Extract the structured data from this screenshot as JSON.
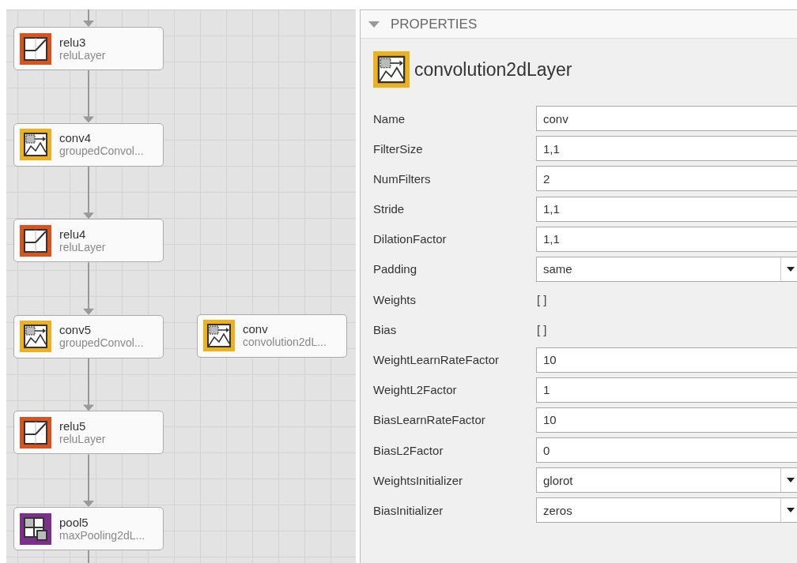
{
  "canvas": {
    "chain": [
      {
        "name": "relu3",
        "type": "reluLayer",
        "kind": "relu"
      },
      {
        "name": "conv4",
        "type": "groupedConvol...",
        "kind": "conv"
      },
      {
        "name": "relu4",
        "type": "reluLayer",
        "kind": "relu"
      },
      {
        "name": "conv5",
        "type": "groupedConvol...",
        "kind": "conv"
      },
      {
        "name": "relu5",
        "type": "reluLayer",
        "kind": "relu"
      },
      {
        "name": "pool5",
        "type": "maxPooling2dL...",
        "kind": "pool"
      }
    ],
    "detached": [
      {
        "name": "conv",
        "type": "convolution2dL...",
        "kind": "conv"
      }
    ]
  },
  "properties": {
    "title": "PROPERTIES",
    "expanded": true,
    "kind": "conv",
    "layer_type": "convolution2dLayer",
    "fields": [
      {
        "label": "Name",
        "value": "conv",
        "kind": "text"
      },
      {
        "label": "FilterSize",
        "value": "1,1",
        "kind": "text"
      },
      {
        "label": "NumFilters",
        "value": "2",
        "kind": "text"
      },
      {
        "label": "Stride",
        "value": "1,1",
        "kind": "text"
      },
      {
        "label": "DilationFactor",
        "value": "1,1",
        "kind": "text"
      },
      {
        "label": "Padding",
        "value": "same",
        "kind": "dropdown"
      },
      {
        "label": "Weights",
        "value": "[ ]",
        "kind": "static"
      },
      {
        "label": "Bias",
        "value": "[ ]",
        "kind": "static"
      },
      {
        "label": "WeightLearnRateFactor",
        "value": "10",
        "kind": "text"
      },
      {
        "label": "WeightL2Factor",
        "value": "1",
        "kind": "text"
      },
      {
        "label": "BiasLearnRateFactor",
        "value": "10",
        "kind": "text"
      },
      {
        "label": "BiasL2Factor",
        "value": "0",
        "kind": "text"
      },
      {
        "label": "WeightsInitializer",
        "value": "glorot",
        "kind": "dropdown"
      },
      {
        "label": "BiasInitializer",
        "value": "zeros",
        "kind": "dropdown"
      }
    ]
  }
}
